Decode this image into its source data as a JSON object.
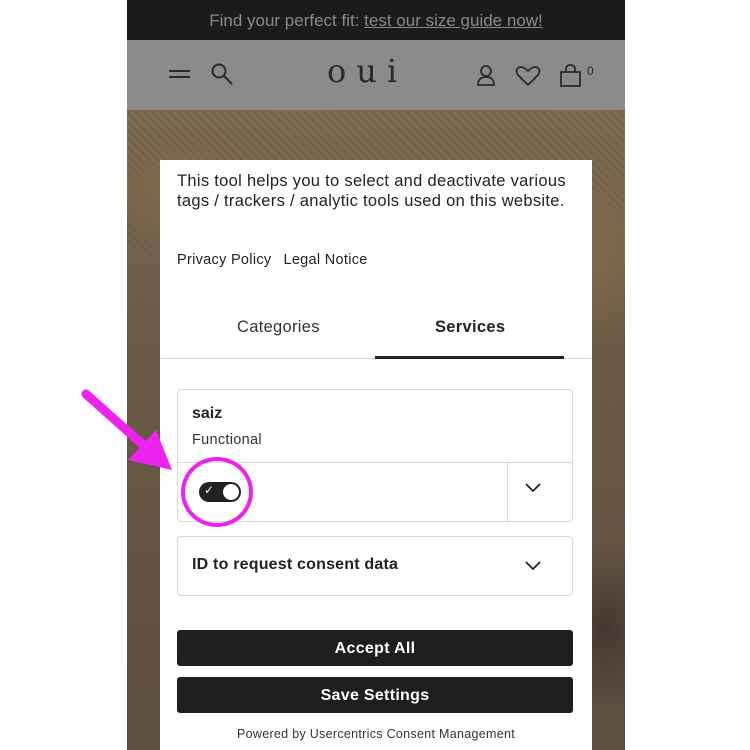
{
  "promo": {
    "text": "Find your perfect fit: ",
    "link": "test our size guide now!"
  },
  "header": {
    "logo": "oui",
    "cart_count": "0"
  },
  "modal": {
    "intro": "This tool helps you to select and deactivate various tags / trackers / analytic tools used on this website.",
    "links": [
      "Privacy Policy",
      "Legal Notice"
    ],
    "tabs": [
      {
        "label": "Categories",
        "active": false
      },
      {
        "label": "Services",
        "active": true
      }
    ],
    "services": [
      {
        "name": "saiz",
        "category": "Functional",
        "enabled": true
      },
      {
        "name": "ID to request consent data"
      }
    ],
    "accept_all_label": "Accept All",
    "save_settings_label": "Save Settings",
    "powered_by": "Powered by Usercentrics Consent Management"
  },
  "annotation": {
    "color": "#ee22ee"
  },
  "colors": {
    "button_bg": "#1e1e1e",
    "promo_bg": "#1b1b1b",
    "toggle_on": "#222222"
  },
  "icons": [
    "menu-icon",
    "search-icon",
    "user-icon",
    "heart-icon",
    "bag-icon",
    "chevron-down-icon",
    "checkmark-icon"
  ]
}
